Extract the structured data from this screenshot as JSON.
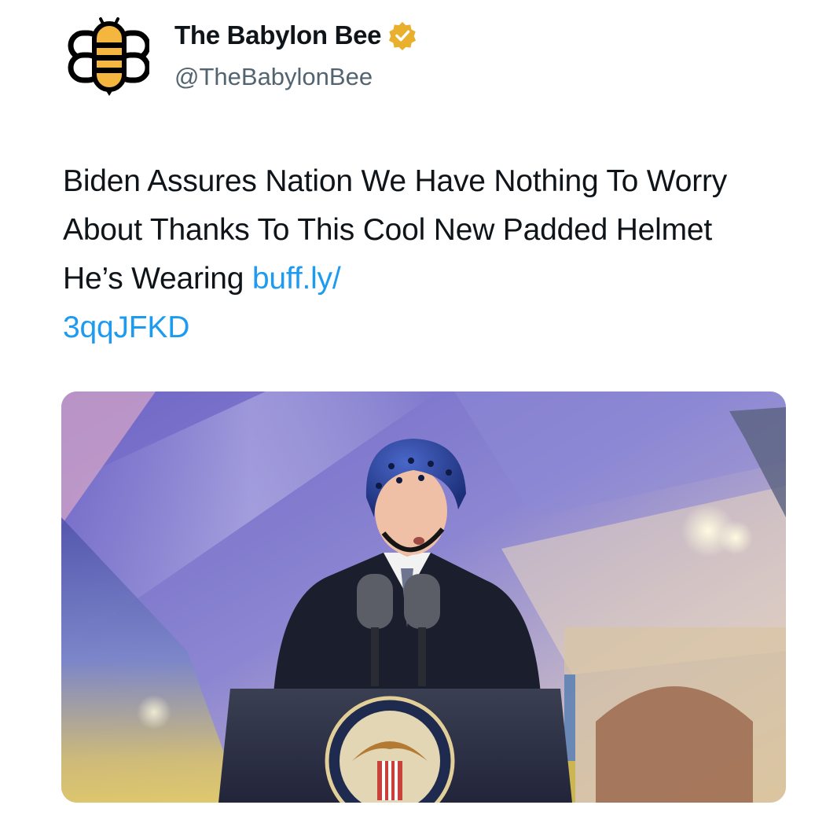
{
  "account": {
    "display_name": "The Babylon Bee",
    "handle": "@TheBabylonBee",
    "avatar_icon": "bee-logo-icon",
    "verified_icon": "verified-badge-icon",
    "verified_color": "#e8b02c"
  },
  "tweet": {
    "text": "Biden Assures Nation We Have Nothing To Worry About Thanks To This Cool New Padded Helmet He’s Wearing ",
    "link_line1": "buff.ly/",
    "link_line2": "3qqJFKD",
    "link_color": "#1d9bf0"
  },
  "media": {
    "icon": "podium-photo-image"
  }
}
